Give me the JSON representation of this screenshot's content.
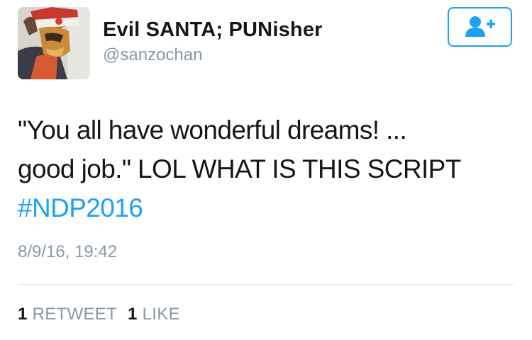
{
  "user": {
    "display_name": "Evil SANTA; PUNisher",
    "handle": "@sanzochan"
  },
  "follow_button": {
    "icon": "add-user-icon"
  },
  "tweet": {
    "text_line_1": "\"You all have wonderful dreams! ...",
    "text_line_2": "good job.\" LOL WHAT IS THIS SCRIPT",
    "hashtag": "#NDP2016",
    "timestamp": "8/9/16, 19:42"
  },
  "stats": {
    "retweets": {
      "count": "1",
      "label": "RETWEET"
    },
    "likes": {
      "count": "1",
      "label": "LIKE"
    }
  },
  "colors": {
    "accent": "#1da1f2",
    "text": "#14171a",
    "muted": "#8899a6",
    "divider": "#e1e8ed"
  }
}
